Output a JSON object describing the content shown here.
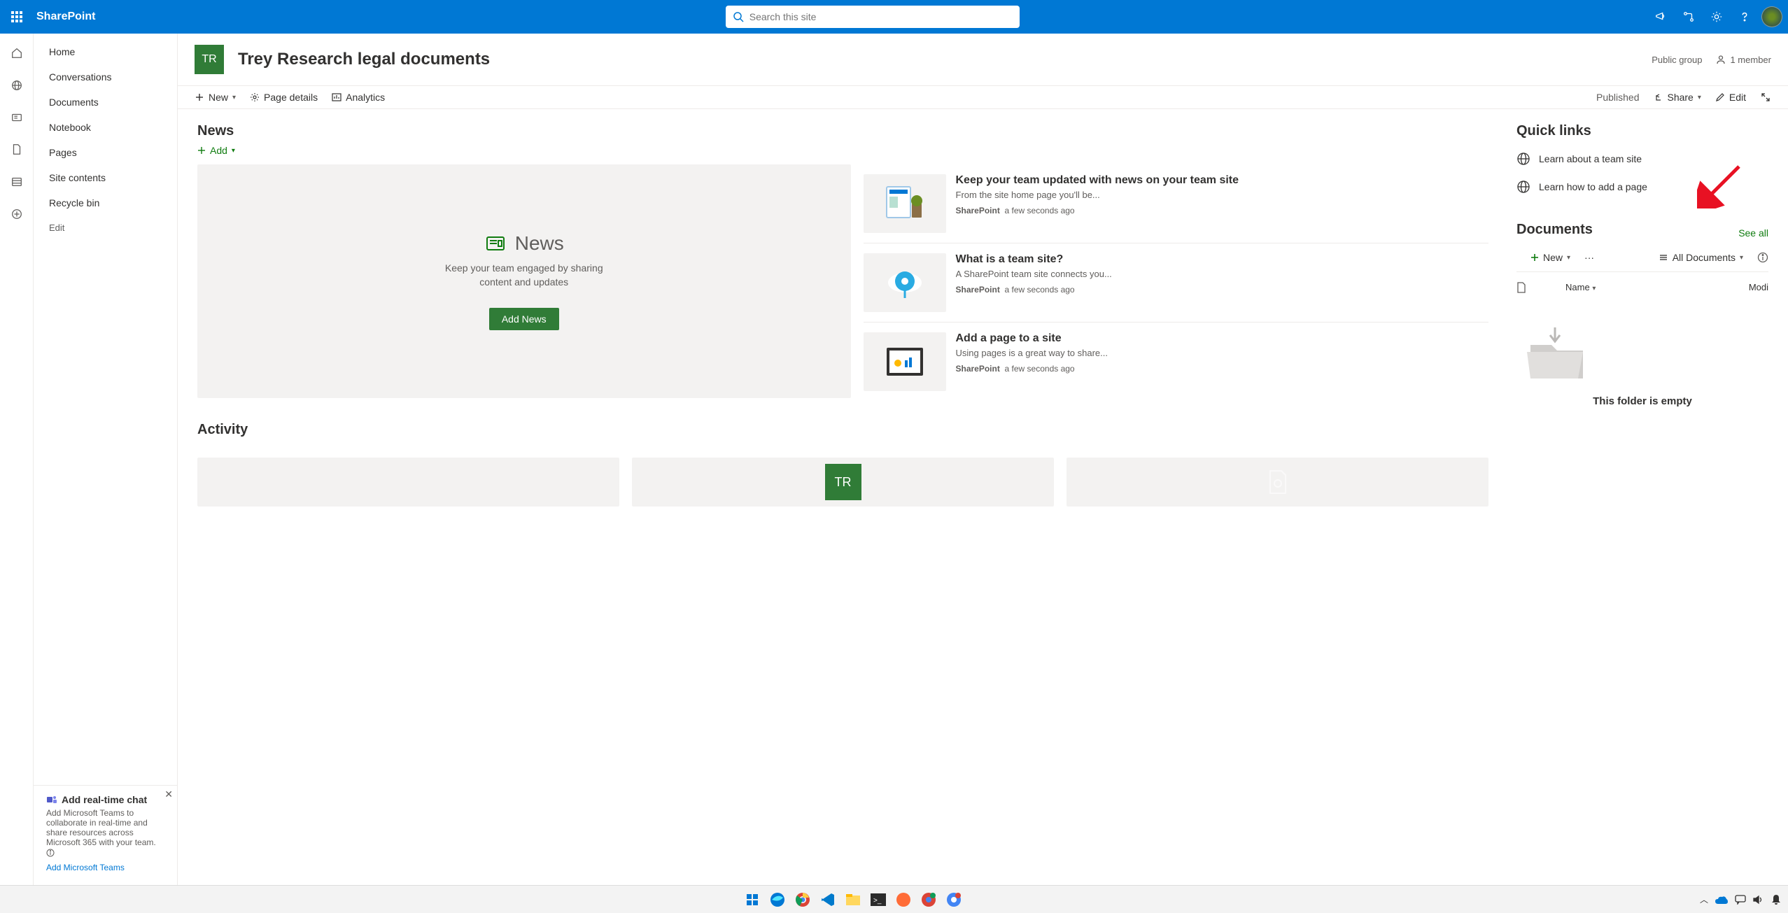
{
  "header": {
    "brand": "SharePoint",
    "search_placeholder": "Search this site"
  },
  "site": {
    "logo_initials": "TR",
    "title": "Trey Research legal documents",
    "group_type": "Public group",
    "members": "1 member"
  },
  "nav": {
    "items": [
      "Home",
      "Conversations",
      "Documents",
      "Notebook",
      "Pages",
      "Site contents",
      "Recycle bin"
    ],
    "edit_label": "Edit"
  },
  "promo": {
    "title": "Add real-time chat",
    "body": "Add Microsoft Teams to collaborate in real-time and share resources across Microsoft 365 with your team.",
    "link": "Add Microsoft Teams"
  },
  "cmd": {
    "new": "New",
    "page_details": "Page details",
    "analytics": "Analytics",
    "published": "Published",
    "share": "Share",
    "edit": "Edit"
  },
  "news": {
    "heading": "News",
    "add_label": "Add",
    "hero_title": "News",
    "hero_sub": "Keep your team engaged by sharing content and updates",
    "hero_btn": "Add News",
    "items": [
      {
        "title": "Keep your team updated with news on your team site",
        "desc": "From the site home page you'll be...",
        "source": "SharePoint",
        "time": "a few seconds ago"
      },
      {
        "title": "What is a team site?",
        "desc": "A SharePoint team site connects you...",
        "source": "SharePoint",
        "time": "a few seconds ago"
      },
      {
        "title": "Add a page to a site",
        "desc": "Using pages is a great way to share...",
        "source": "SharePoint",
        "time": "a few seconds ago"
      }
    ]
  },
  "activity": {
    "heading": "Activity",
    "tile_initials": "TR"
  },
  "quicklinks": {
    "heading": "Quick links",
    "items": [
      "Learn about a team site",
      "Learn how to add a page"
    ]
  },
  "documents": {
    "heading": "Documents",
    "see_all": "See all",
    "new": "New",
    "view": "All Documents",
    "col_name": "Name",
    "col_modified": "Modi",
    "empty": "This folder is empty"
  },
  "taskbar": {
    "time": "",
    "tray": ""
  }
}
